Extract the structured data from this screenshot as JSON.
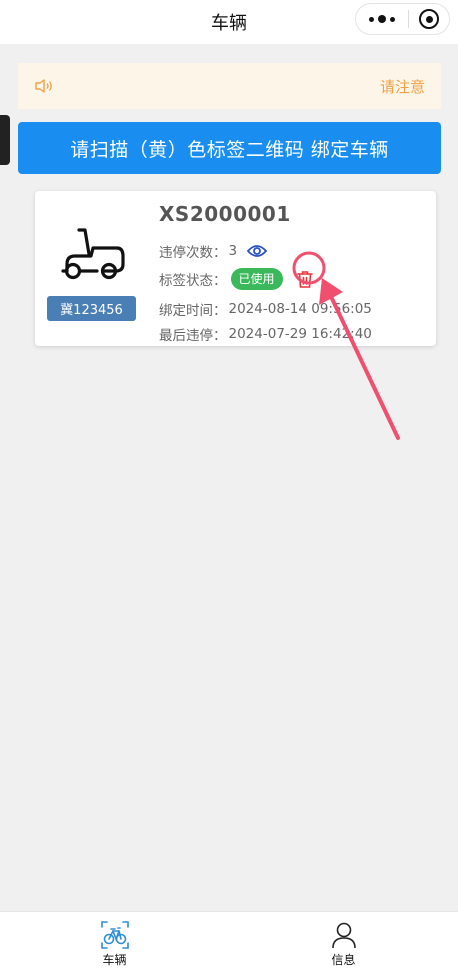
{
  "navbar": {
    "title": "车辆"
  },
  "notice": {
    "text": "请注意"
  },
  "scan_button": {
    "label": "请扫描（黄）色标签二维码 绑定车辆"
  },
  "vehicle": {
    "id": "XS2000001",
    "plate": "冀123456",
    "violations_label": "违停次数：",
    "violations_count": "3",
    "status_label": "标签状态：",
    "status_value": "已使用",
    "bind_label": "绑定时间：",
    "bind_time": "2024-08-14 09:56:05",
    "last_label": "最后违停：",
    "last_time": "2024-07-29 16:42:40"
  },
  "tabbar": {
    "tabs": [
      {
        "label": "车辆",
        "icon": "bicycle-scan-icon",
        "active": true
      },
      {
        "label": "信息",
        "icon": "user-icon",
        "active": false
      }
    ]
  },
  "colors": {
    "primary": "#1a8ef0",
    "notice_text": "#f0a044",
    "notice_bg": "#fdf6e8",
    "status_green": "#3cb85c",
    "plate_blue": "#4a7fb5",
    "danger_red": "#e8343c",
    "annotation": "#f0506e"
  }
}
